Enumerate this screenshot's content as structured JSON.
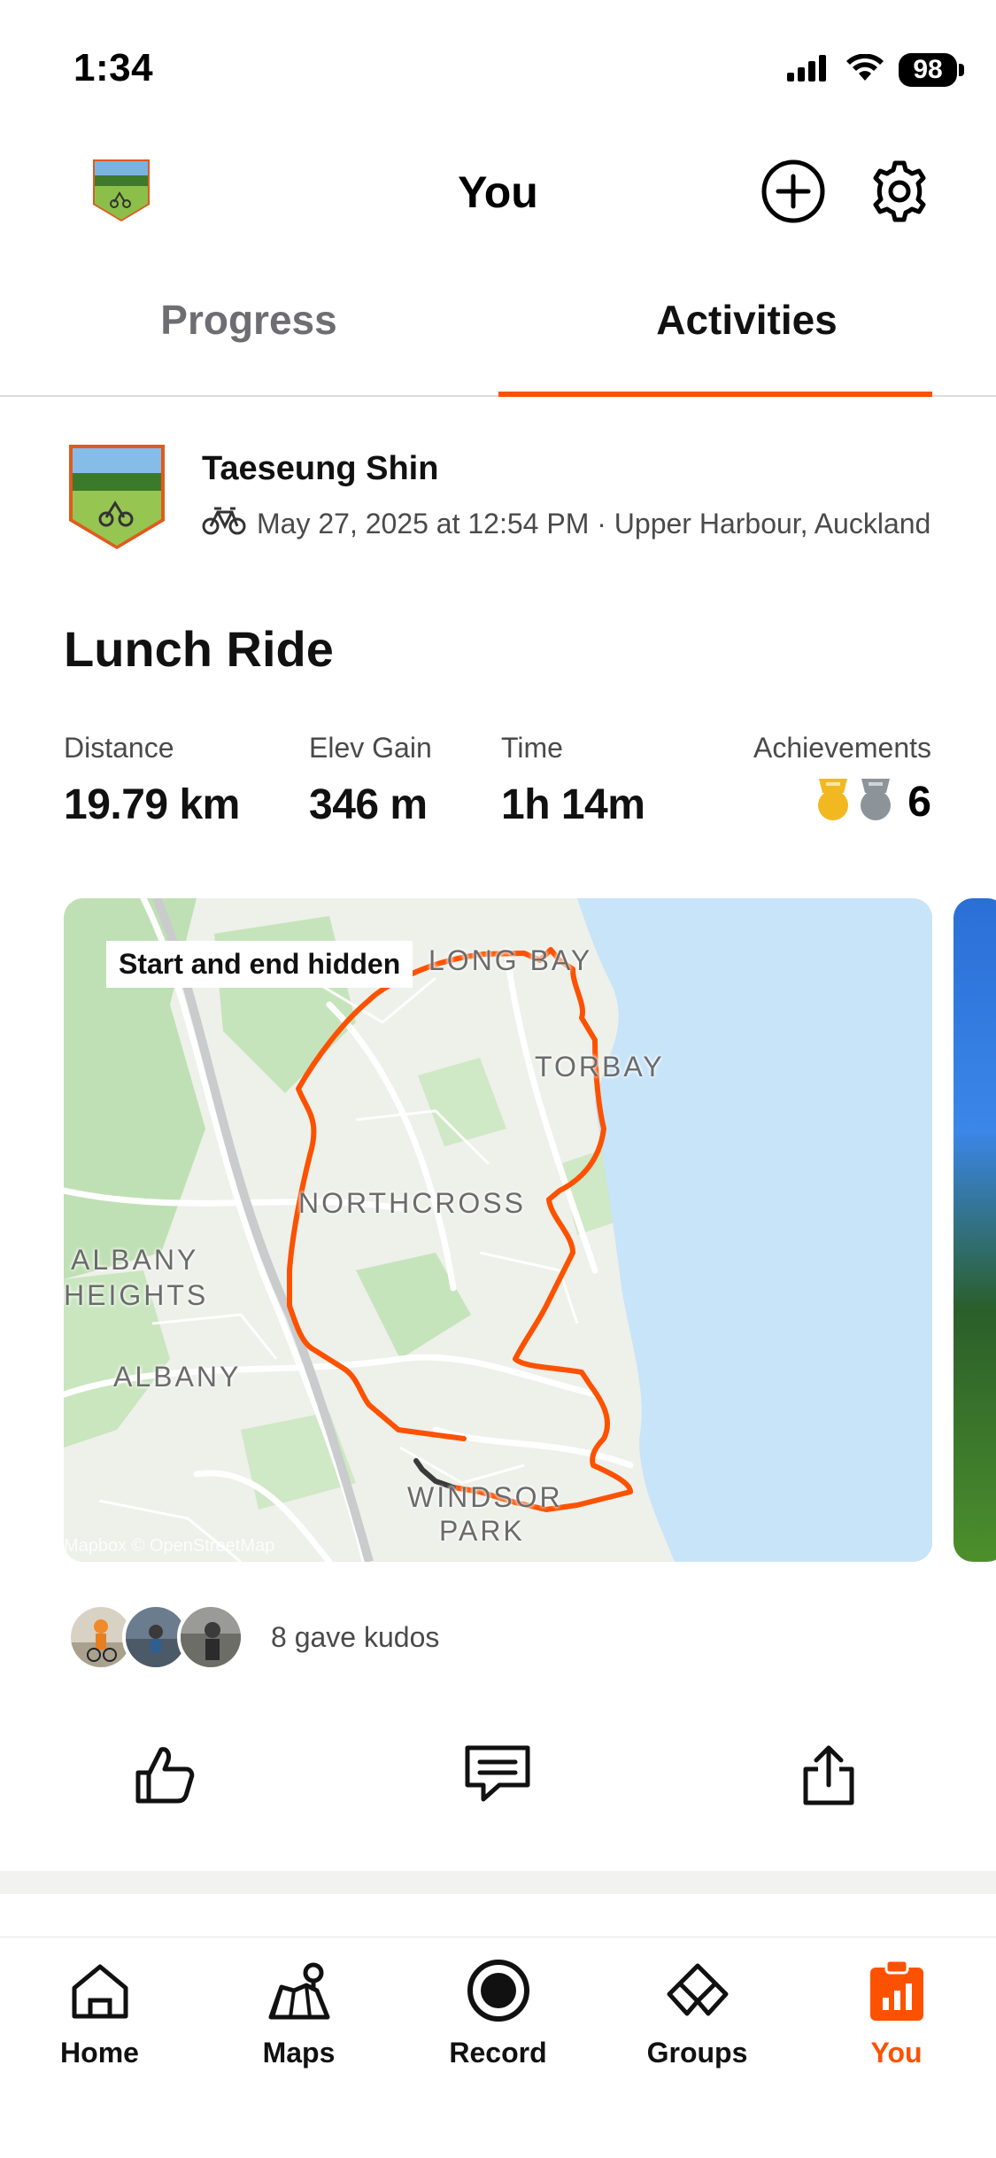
{
  "status_bar": {
    "time": "1:34",
    "battery": "98"
  },
  "header": {
    "title": "You"
  },
  "tabs": [
    {
      "label": "Progress",
      "active": false
    },
    {
      "label": "Activities",
      "active": true
    }
  ],
  "activity": {
    "athlete_name": "Taeseung Shin",
    "meta": "May 27, 2025 at 12:54 PM · Upper Harbour, Auckland",
    "title": "Lunch Ride",
    "stats": [
      {
        "label": "Distance",
        "value": "19.79 km"
      },
      {
        "label": "Elev Gain",
        "value": "346 m"
      },
      {
        "label": "Time",
        "value": "1h 14m"
      }
    ],
    "achievements": {
      "label": "Achievements",
      "count": "6"
    },
    "map": {
      "badge": "Start and end hidden",
      "attribution": "Mapbox © OpenStreetMap",
      "places": [
        "LONG BAY",
        "TORBAY",
        "NORTHCROSS",
        "ALBANY",
        "HEIGHTS",
        "ALBANY",
        "WINDSOR",
        "PARK"
      ]
    },
    "kudos_text": "8 gave kudos"
  },
  "nav": [
    {
      "label": "Home",
      "icon": "home-icon",
      "active": false
    },
    {
      "label": "Maps",
      "icon": "maps-icon",
      "active": false
    },
    {
      "label": "Record",
      "icon": "record-icon",
      "active": false
    },
    {
      "label": "Groups",
      "icon": "groups-icon",
      "active": false
    },
    {
      "label": "You",
      "icon": "you-icon",
      "active": true
    }
  ],
  "colors": {
    "accent": "#fc5200",
    "water": "#c8e4f8",
    "park": "#b9dfb0",
    "medal_gold": "#f2b81f",
    "medal_silver": "#8d9499"
  }
}
